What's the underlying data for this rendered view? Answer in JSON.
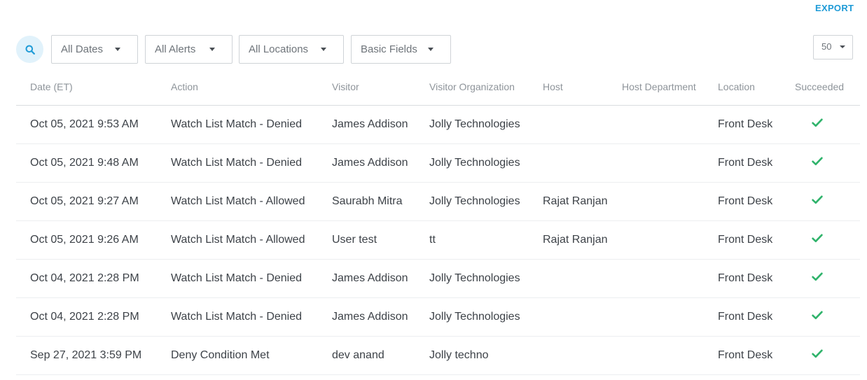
{
  "header": {
    "export_label": "EXPORT"
  },
  "filters": {
    "search_icon": "search-icon",
    "dates": "All Dates",
    "alerts": "All Alerts",
    "locations": "All Locations",
    "fields": "Basic Fields",
    "page_size": "50"
  },
  "table": {
    "columns": [
      "Date (ET)",
      "Action",
      "Visitor",
      "Visitor Organization",
      "Host",
      "Host Department",
      "Location",
      "Succeeded"
    ],
    "rows": [
      {
        "date": "Oct 05, 2021 9:53 AM",
        "action": "Watch List Match - Denied",
        "visitor": "James Addison",
        "org": "Jolly Technologies",
        "host": "",
        "dept": "",
        "location": "Front Desk",
        "succeeded": "check-icon"
      },
      {
        "date": "Oct 05, 2021 9:48 AM",
        "action": "Watch List Match - Denied",
        "visitor": "James Addison",
        "org": "Jolly Technologies",
        "host": "",
        "dept": "",
        "location": "Front Desk",
        "succeeded": "check-icon"
      },
      {
        "date": "Oct 05, 2021 9:27 AM",
        "action": "Watch List Match - Allowed",
        "visitor": "Saurabh Mitra",
        "org": "Jolly Technologies",
        "host": "Rajat Ranjan",
        "dept": "",
        "location": "Front Desk",
        "succeeded": "check-icon"
      },
      {
        "date": "Oct 05, 2021 9:26 AM",
        "action": "Watch List Match - Allowed",
        "visitor": "User test",
        "org": "tt",
        "host": "Rajat Ranjan",
        "dept": "",
        "location": "Front Desk",
        "succeeded": "check-icon"
      },
      {
        "date": "Oct 04, 2021 2:28 PM",
        "action": "Watch List Match - Denied",
        "visitor": "James Addison",
        "org": "Jolly Technologies",
        "host": "",
        "dept": "",
        "location": "Front Desk",
        "succeeded": "check-icon"
      },
      {
        "date": "Oct 04, 2021 2:28 PM",
        "action": "Watch List Match - Denied",
        "visitor": "James Addison",
        "org": "Jolly Technologies",
        "host": "",
        "dept": "",
        "location": "Front Desk",
        "succeeded": "check-icon"
      },
      {
        "date": "Sep 27, 2021 3:59 PM",
        "action": "Deny Condition Met",
        "visitor": "dev anand",
        "org": "Jolly techno",
        "host": "",
        "dept": "",
        "location": "Front Desk",
        "succeeded": "check-icon"
      }
    ]
  },
  "colors": {
    "accent": "#1f9bd7",
    "success": "#2fb36b",
    "search_bg": "#e1f2fb"
  }
}
